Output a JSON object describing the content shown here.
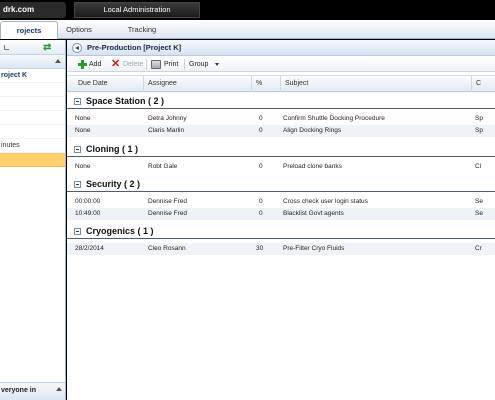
{
  "topbar": {
    "logo_text": "drk.com",
    "local_admin": "Local Administration"
  },
  "nav": {
    "tabs": [
      {
        "label": "rojects"
      },
      {
        "label": "Options"
      },
      {
        "label": "Tracking"
      }
    ]
  },
  "left_panel": {
    "rows": [
      {
        "label": "roject K"
      },
      {
        "label": ""
      },
      {
        "label": ""
      },
      {
        "label": ""
      },
      {
        "label": ""
      },
      {
        "label": "inutes"
      },
      {
        "label": ""
      }
    ],
    "footer": "veryone in"
  },
  "main": {
    "title": "Pre-Production [Project K]",
    "toolbar": {
      "add": "Add",
      "delete": "Delete",
      "print": "Print",
      "group": "Group"
    },
    "columns": {
      "due": "Due Date",
      "assignee": "Assignee",
      "pct": "%",
      "subject": "Subject",
      "last": "C"
    },
    "groups": [
      {
        "label": "Space Station ( 2 )",
        "rows": [
          {
            "due": "None",
            "assignee": "Detra Johnny",
            "pct": "0",
            "subject": "Confirm Shuttle Docking Procedure",
            "last": "Sp"
          },
          {
            "due": "None",
            "assignee": "Claris Marlin",
            "pct": "0",
            "subject": "Align Docking Rings",
            "last": "Sp"
          }
        ]
      },
      {
        "label": "Cloning ( 1 )",
        "rows": [
          {
            "due": "None",
            "assignee": "Robt Gale",
            "pct": "0",
            "subject": "Preload clone banks",
            "last": "Cl"
          }
        ]
      },
      {
        "label": "Security ( 2 )",
        "rows": [
          {
            "due": "00:00:00",
            "assignee": "Dennise Fred",
            "pct": "0",
            "subject": "Cross check user login status",
            "last": "Se"
          },
          {
            "due": "10:49:00",
            "assignee": "Dennise Fred",
            "pct": "0",
            "subject": "Blacklist Govt agents",
            "last": "Se"
          }
        ]
      },
      {
        "label": "Cryogenics ( 1 )",
        "rows": [
          {
            "due": "28/2/2014",
            "assignee": "Cleo Rosann",
            "pct": "30",
            "subject": "Pre-Filter Cryo Fluids",
            "last": "Cr"
          }
        ]
      }
    ]
  }
}
